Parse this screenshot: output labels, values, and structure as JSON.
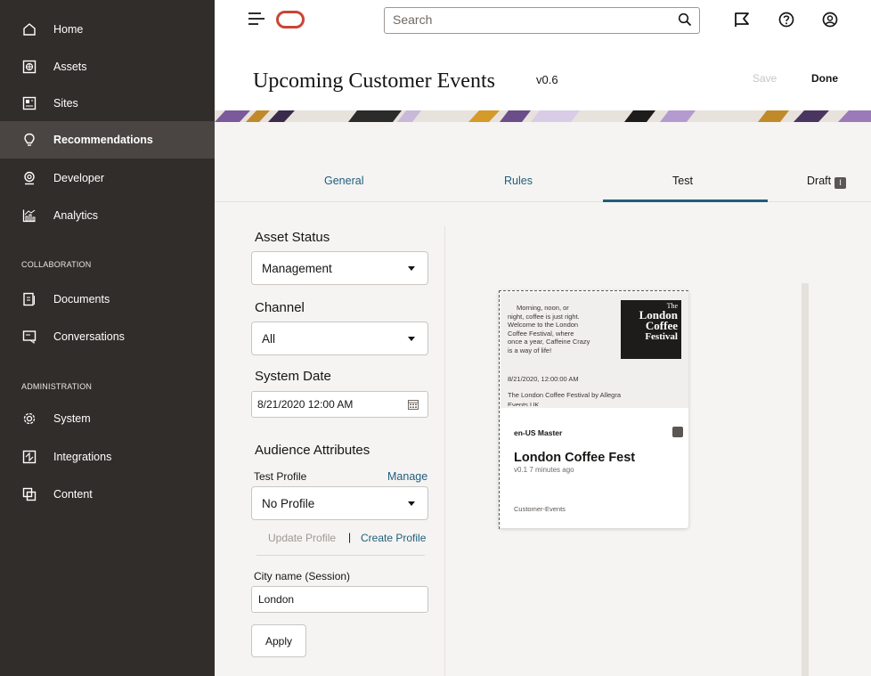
{
  "sidebar": {
    "items": [
      {
        "label": "Home",
        "icon": "home-icon"
      },
      {
        "label": "Assets",
        "icon": "assets-icon"
      },
      {
        "label": "Sites",
        "icon": "sites-icon"
      },
      {
        "label": "Recommendations",
        "icon": "lightbulb-icon",
        "active": true
      },
      {
        "label": "Developer",
        "icon": "developer-icon"
      },
      {
        "label": "Analytics",
        "icon": "analytics-icon"
      }
    ],
    "collab_heading": "COLLABORATION",
    "collab_items": [
      {
        "label": "Documents",
        "icon": "documents-icon"
      },
      {
        "label": "Conversations",
        "icon": "conversations-icon"
      }
    ],
    "admin_heading": "ADMINISTRATION",
    "admin_items": [
      {
        "label": "System",
        "icon": "gear-icon"
      },
      {
        "label": "Integrations",
        "icon": "integrations-icon"
      },
      {
        "label": "Content",
        "icon": "content-icon"
      }
    ]
  },
  "topbar": {
    "search_placeholder": "Search",
    "icons": [
      "menu-icon",
      "oracle-logo",
      "search-icon",
      "flag-icon",
      "help-icon",
      "user-icon"
    ]
  },
  "header": {
    "title": "Upcoming Customer Events",
    "version": "v0.6",
    "save_label": "Save",
    "done_label": "Done"
  },
  "tabs": {
    "general": "General",
    "rules": "Rules",
    "test": "Test",
    "draft": "Draft",
    "draft_badge": "I"
  },
  "form": {
    "asset_status_label": "Asset Status",
    "asset_status_value": "Management",
    "channel_label": "Channel",
    "channel_value": "All",
    "system_date_label": "System Date",
    "system_date_value": "8/21/2020 12:00 AM",
    "audience_label": "Audience Attributes",
    "test_profile_label": "Test Profile",
    "manage_label": "Manage",
    "profile_value": "No Profile",
    "update_profile": "Update Profile",
    "separator": "|",
    "create_profile": "Create Profile",
    "city_label": "City name (Session)",
    "city_value": "London",
    "apply_label": "Apply"
  },
  "card": {
    "body_lines": [
      "Morning, noon, or",
      "night, coffee is just right.",
      "Welcome to the London",
      "Coffee Festival, where",
      "once a year, Caffeine Crazy",
      "is a way of life!"
    ],
    "date": "8/21/2020, 12:00:00 AM",
    "description": "The London Coffee Festival by Allegra",
    "description_2": "Events UK",
    "poster_lines": [
      "The",
      "London",
      "Coffee",
      "Festival"
    ],
    "locale": "en-US  Master",
    "title": "London Coffee Fest",
    "meta": "v0.1   7 minutes ago",
    "category": "Customer-Events"
  },
  "colors": {
    "sidebar_bg": "#312d2a",
    "sidebar_active": "#4a4542",
    "link": "#1f5e7d",
    "brand_red": "#c74634"
  }
}
